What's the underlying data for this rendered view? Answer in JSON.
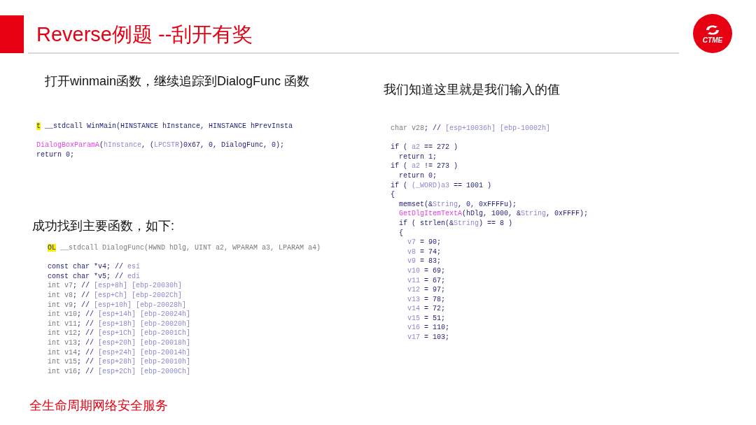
{
  "title": "Reverse例题 --刮开有奖",
  "logo": {
    "text": "CTME"
  },
  "notes": [
    {
      "text": "打开winmain函数，继续追踪到DialogFunc 函数"
    },
    {
      "text": "成功找到主要函数，如下:"
    },
    {
      "text": "我们知道这里就是我们输入的值"
    }
  ],
  "code_blocks": [
    {
      "groups": [
        {
          "lines": [
            [
              {
                "text": "t",
                "kind": "mark"
              },
              {
                "text": " __stdcall WinMain(HINSTANCE hInstance, HINSTANCE hPrevInsta",
                "kind": "code"
              }
            ]
          ]
        },
        {
          "lines": [
            [
              {
                "text": "DialogBoxParamA",
                "kind": "func"
              },
              {
                "text": "(",
                "kind": "code"
              },
              {
                "text": "hInstance",
                "kind": "var"
              },
              {
                "text": ", (",
                "kind": "code"
              },
              {
                "text": "LPCSTR",
                "kind": "var"
              },
              {
                "text": ")0x67, 0, DialogFunc, 0);",
                "kind": "code"
              }
            ],
            [
              {
                "text": "return 0;",
                "kind": "code"
              }
            ]
          ]
        }
      ]
    },
    {
      "groups": [
        {
          "lines": [
            [
              {
                "text": "OL",
                "kind": "mark"
              },
              {
                "text": " __stdcall DialogFunc(HWND hDlg, UINT a2, WPARAM a3, LPARAM a4)",
                "kind": "muted"
              }
            ]
          ]
        },
        {
          "lines": [
            [
              {
                "text": "const char *v4; // ",
                "kind": "code"
              },
              {
                "text": "esi",
                "kind": "var"
              }
            ],
            [
              {
                "text": "const char *v5; // ",
                "kind": "code"
              },
              {
                "text": "edi",
                "kind": "var"
              }
            ],
            [
              {
                "text": "int v7",
                "kind": "muted"
              },
              {
                "text": "; // ",
                "kind": "code"
              },
              {
                "text": "[esp+8h] [ebp-20030h]",
                "kind": "var"
              }
            ],
            [
              {
                "text": "int v8",
                "kind": "muted"
              },
              {
                "text": "; // ",
                "kind": "code"
              },
              {
                "text": "[esp+Ch] [ebp-2002Ch]",
                "kind": "var"
              }
            ],
            [
              {
                "text": "int v9",
                "kind": "muted"
              },
              {
                "text": "; // ",
                "kind": "code"
              },
              {
                "text": "[esp+10h] [ebp-20028h]",
                "kind": "var"
              }
            ],
            [
              {
                "text": "int v10",
                "kind": "muted"
              },
              {
                "text": "; // ",
                "kind": "code"
              },
              {
                "text": "[esp+14h] [ebp-20024h]",
                "kind": "var"
              }
            ],
            [
              {
                "text": "int v11",
                "kind": "muted"
              },
              {
                "text": "; // ",
                "kind": "code"
              },
              {
                "text": "[esp+18h] [ebp-20020h]",
                "kind": "var"
              }
            ],
            [
              {
                "text": "int v12",
                "kind": "muted"
              },
              {
                "text": "; // ",
                "kind": "code"
              },
              {
                "text": "[esp+1Ch] [ebp-2001Ch]",
                "kind": "var"
              }
            ],
            [
              {
                "text": "int v13",
                "kind": "muted"
              },
              {
                "text": "; // ",
                "kind": "code"
              },
              {
                "text": "[esp+20h] [ebp-20018h]",
                "kind": "var"
              }
            ],
            [
              {
                "text": "int v14",
                "kind": "muted"
              },
              {
                "text": "; // ",
                "kind": "code"
              },
              {
                "text": "[esp+24h] [ebp-20014h]",
                "kind": "var"
              }
            ],
            [
              {
                "text": "int v15",
                "kind": "muted"
              },
              {
                "text": "; // ",
                "kind": "code"
              },
              {
                "text": "[esp+28h] [ebp-20010h]",
                "kind": "var"
              }
            ],
            [
              {
                "text": "int v16",
                "kind": "muted"
              },
              {
                "text": "; // ",
                "kind": "code"
              },
              {
                "text": "[esp+2Ch] [ebp-2000Ch]",
                "kind": "var"
              }
            ]
          ]
        }
      ]
    },
    {
      "groups": [
        {
          "lines": [
            [
              {
                "text": "char v28",
                "kind": "muted"
              },
              {
                "text": "; // ",
                "kind": "code"
              },
              {
                "text": "[esp+10036h] [ebp-10002h]",
                "kind": "var"
              }
            ]
          ]
        },
        {
          "lines": [
            [
              {
                "text": "if ( ",
                "kind": "code"
              },
              {
                "text": "a2",
                "kind": "var"
              },
              {
                "text": " == 272 )",
                "kind": "code"
              }
            ],
            [
              {
                "text": "  return 1;",
                "kind": "code"
              }
            ],
            [
              {
                "text": "if ( ",
                "kind": "code"
              },
              {
                "text": "a2",
                "kind": "var"
              },
              {
                "text": " != 273 )",
                "kind": "code"
              }
            ],
            [
              {
                "text": "  return 0;",
                "kind": "code"
              }
            ],
            [
              {
                "text": "if ( ",
                "kind": "code"
              },
              {
                "text": "(_WORD)a3",
                "kind": "var"
              },
              {
                "text": " == 1001 )",
                "kind": "code"
              }
            ],
            [
              {
                "text": "{",
                "kind": "code"
              }
            ],
            [
              {
                "text": "  memset(&",
                "kind": "code"
              },
              {
                "text": "String",
                "kind": "var"
              },
              {
                "text": ", 0, 0xFFFFu);",
                "kind": "code"
              }
            ],
            [
              {
                "text": "  GetDlgItemTextA",
                "kind": "func"
              },
              {
                "text": "(hDlg, 1000, &",
                "kind": "code"
              },
              {
                "text": "String",
                "kind": "var"
              },
              {
                "text": ", 0xFFFF);",
                "kind": "code"
              }
            ],
            [
              {
                "text": "  if ( strlen(&",
                "kind": "code"
              },
              {
                "text": "String",
                "kind": "var"
              },
              {
                "text": ") == 8 )",
                "kind": "code"
              }
            ],
            [
              {
                "text": "  {",
                "kind": "code"
              }
            ],
            [
              {
                "text": "    v7",
                "kind": "var"
              },
              {
                "text": " = 90;",
                "kind": "code"
              }
            ],
            [
              {
                "text": "    v8",
                "kind": "var"
              },
              {
                "text": " = 74;",
                "kind": "code"
              }
            ],
            [
              {
                "text": "    v9",
                "kind": "var"
              },
              {
                "text": " = 83;",
                "kind": "code"
              }
            ],
            [
              {
                "text": "    v10",
                "kind": "var"
              },
              {
                "text": " = 69;",
                "kind": "code"
              }
            ],
            [
              {
                "text": "    v11",
                "kind": "var"
              },
              {
                "text": " = 67;",
                "kind": "code"
              }
            ],
            [
              {
                "text": "    v12",
                "kind": "var"
              },
              {
                "text": " = 97;",
                "kind": "code"
              }
            ],
            [
              {
                "text": "    v13",
                "kind": "var"
              },
              {
                "text": " = 78;",
                "kind": "code"
              }
            ],
            [
              {
                "text": "    v14",
                "kind": "var"
              },
              {
                "text": " = 72;",
                "kind": "code"
              }
            ],
            [
              {
                "text": "    v15",
                "kind": "var"
              },
              {
                "text": " = 51;",
                "kind": "code"
              }
            ],
            [
              {
                "text": "    v16",
                "kind": "var"
              },
              {
                "text": " = 110;",
                "kind": "code"
              }
            ],
            [
              {
                "text": "    v17",
                "kind": "var"
              },
              {
                "text": " = 103;",
                "kind": "code"
              }
            ]
          ]
        }
      ]
    }
  ],
  "footer": "全生命周期网络安全服务"
}
